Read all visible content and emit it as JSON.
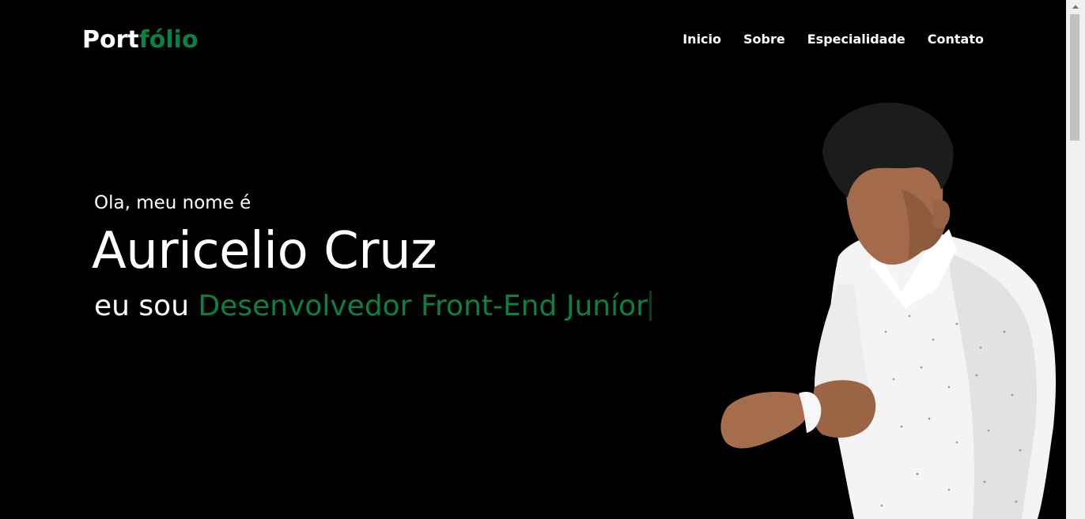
{
  "header": {
    "logo_main": "Port",
    "logo_accent": "fólio",
    "nav": [
      {
        "label": "Inicio"
      },
      {
        "label": "Sobre"
      },
      {
        "label": "Especialidade"
      },
      {
        "label": "Contato"
      }
    ]
  },
  "hero": {
    "intro": "Ola, meu nome é",
    "name": "Auricelio Cruz",
    "role_prefix": "eu sou ",
    "role": "Desenvolvedor Front-End Juníor"
  },
  "colors": {
    "background": "#000000",
    "accent": "#0b8043",
    "text": "#ffffff"
  },
  "icons": {
    "scroll_up": "chevron-up-icon"
  }
}
